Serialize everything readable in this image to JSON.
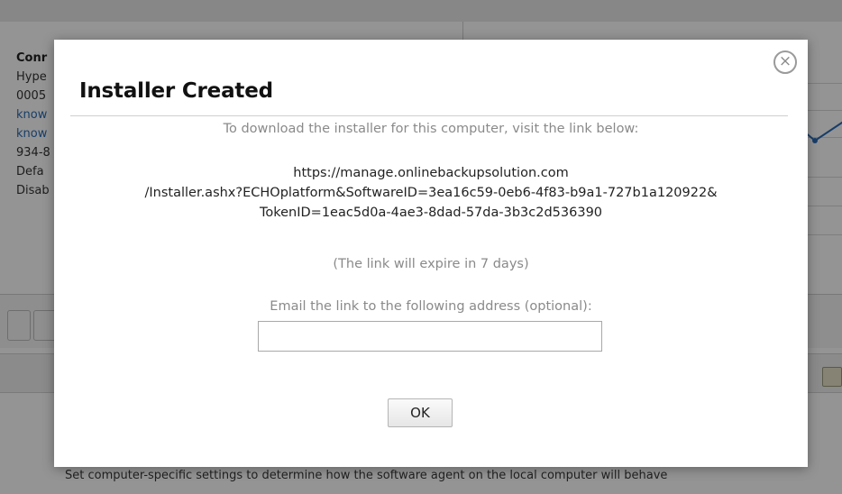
{
  "background": {
    "left_list": [
      {
        "text": "Conr",
        "style": "heading"
      },
      {
        "text": "Hype",
        "style": "plain"
      },
      {
        "text": "0005",
        "style": "plain"
      },
      {
        "text": "know",
        "style": "link"
      },
      {
        "text": "know",
        "style": "link"
      },
      {
        "text": "934-8",
        "style": "plain"
      },
      {
        "text": "Defa",
        "style": "plain"
      },
      {
        "text": "Disab",
        "style": "plain"
      }
    ],
    "footer_text": "Set computer-specific settings to determine how the software agent on the local computer will behave"
  },
  "dialog": {
    "title": "Installer Created",
    "close_glyph": "×",
    "intro": "To download the installer for this computer, visit the link below:",
    "link_lines": [
      "https://manage.onlinebackupsolution.com",
      "/Installer.ashx?ECHOplatform&SoftwareID=3ea16c59-0eb6-4f83-b9a1-727b1a120922&",
      "TokenID=1eac5d0a-4ae3-8dad-57da-3b3c2d536390"
    ],
    "expire_note": "(The link will expire in 7 days)",
    "email_label": "Email the link to the following address (optional):",
    "email_value": "",
    "ok_label": "OK"
  },
  "colors": {
    "overlay": "#6b6b6b",
    "link_blue": "#2a6bb5",
    "muted_text": "#8a8a8a"
  }
}
